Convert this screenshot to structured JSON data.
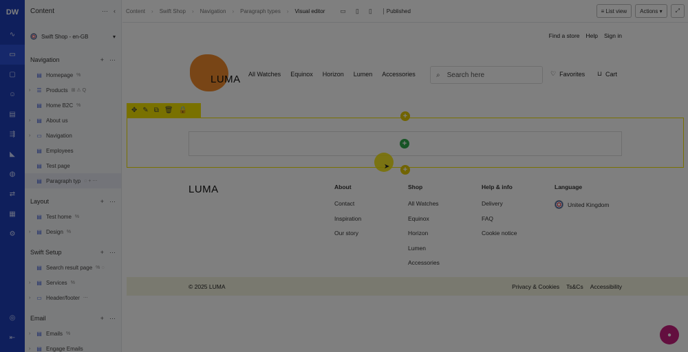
{
  "app": {
    "logo": "DW"
  },
  "rail": {
    "icons": [
      "chart-icon",
      "monitor-icon",
      "folder-icon",
      "user-icon",
      "box-icon",
      "flow-icon",
      "megaphone-icon",
      "globe-icon",
      "swap-icon",
      "grid-icon",
      "settings-icon"
    ],
    "bottom_icons": [
      "help-icon",
      "collapse-icon"
    ]
  },
  "sidebar": {
    "title": "Content",
    "site": {
      "label": "Swift Shop - en-GB"
    },
    "sections": [
      {
        "title": "Navigation",
        "items": [
          {
            "label": "Homepage",
            "caret": false,
            "extra": "%"
          },
          {
            "label": "Products",
            "caret": true,
            "extra": "⊞ ⚠ Q"
          },
          {
            "label": "Home B2C",
            "caret": false,
            "extra": "%"
          },
          {
            "label": "About us",
            "caret": true,
            "extra": ""
          },
          {
            "label": "Navigation",
            "caret": true,
            "extra": ""
          },
          {
            "label": "Employees",
            "caret": false,
            "extra": ""
          },
          {
            "label": "Test page",
            "caret": false,
            "extra": ""
          },
          {
            "label": "Paragraph typ",
            "caret": false,
            "extra": "◌ + ⋯",
            "selected": true
          }
        ]
      },
      {
        "title": "Layout",
        "items": [
          {
            "label": "Test home",
            "caret": false,
            "extra": "%"
          },
          {
            "label": "Design",
            "caret": true,
            "extra": "%"
          }
        ]
      },
      {
        "title": "Swift Setup",
        "items": [
          {
            "label": "Search result page",
            "caret": false,
            "extra": "% ◌"
          },
          {
            "label": "Services",
            "caret": true,
            "extra": "%"
          },
          {
            "label": "Header/footer",
            "caret": true,
            "extra": "⋯"
          }
        ]
      },
      {
        "title": "Email",
        "items": [
          {
            "label": "Emails",
            "caret": true,
            "extra": "%"
          },
          {
            "label": "Engage Emails",
            "caret": true,
            "extra": ""
          }
        ]
      }
    ]
  },
  "toolbar": {
    "breadcrumb": [
      "Content",
      "Swift Shop",
      "Navigation",
      "Paragraph types",
      "Visual editor"
    ],
    "status": "Published",
    "list_view": "≡ List view",
    "actions": "Actions ▾",
    "expand": "⤢"
  },
  "site": {
    "top_links": [
      "Find a store",
      "Help",
      "Sign in"
    ],
    "brand": "LUMA",
    "nav": [
      "All Watches",
      "Equinox",
      "Horizon",
      "Lumen",
      "Accessories"
    ],
    "search_placeholder": "Search here",
    "favorites": "Favorites",
    "cart": "Cart",
    "footer": {
      "brand": "LUMA",
      "columns": [
        {
          "title": "About",
          "links": [
            "Contact",
            "Inspiration",
            "Our story"
          ]
        },
        {
          "title": "Shop",
          "links": [
            "All Watches",
            "Equinox",
            "Horizon",
            "Lumen",
            "Accessories"
          ]
        },
        {
          "title": "Help & info",
          "links": [
            "Delivery",
            "FAQ",
            "Cookie notice"
          ]
        }
      ],
      "language_title": "Language",
      "language_value": "United Kingdom",
      "copyright": "© 2025 LUMA",
      "legal": [
        "Privacy & Cookies",
        "Ts&Cs",
        "Accessibility"
      ]
    }
  },
  "colors": {
    "rail": "#1f3fb8",
    "brand_orange": "#f08a2c",
    "edit_yellow": "#f2e200",
    "chat": "#c71e7e"
  }
}
